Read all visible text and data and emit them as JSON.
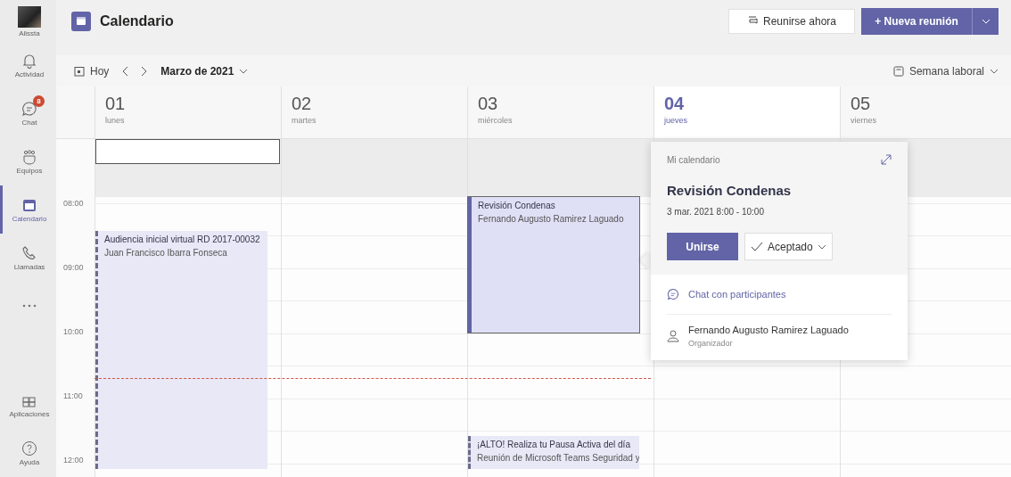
{
  "rail": {
    "profile": {
      "label": "Alissta"
    },
    "items": [
      {
        "label": "Actividad",
        "selected": false
      },
      {
        "label": "Chat",
        "selected": false,
        "badge": "8"
      },
      {
        "label": "Equipos",
        "selected": false
      },
      {
        "label": "Calendario",
        "selected": true
      },
      {
        "label": "Llamadas",
        "selected": false
      },
      {
        "selected": false
      }
    ],
    "bottom_items": [
      {
        "label": "Aplicaciones",
        "selected": false
      },
      {
        "label": "Ayuda",
        "selected": false
      }
    ]
  },
  "header": {
    "title": "Calendario",
    "meet_now": "Reunirse ahora",
    "new_meeting": "+ Nueva reunión"
  },
  "toolbar": {
    "today": "Hoy",
    "month": "Marzo de 2021",
    "view": "Semana laboral"
  },
  "times": [
    "08:00",
    "09:00",
    "10:00",
    "11:00",
    "12:00"
  ],
  "days": [
    {
      "number": "01",
      "weekday": "lunes",
      "selected": false,
      "events": [
        {
          "kind": "outline",
          "selected": false
        },
        {
          "kind": "tentative",
          "title": "Audiencia inicial virtual RD 2017-00032",
          "subtitle": "Juan Francisco Ibarra Fonseca",
          "selected": false
        }
      ]
    },
    {
      "number": "02",
      "weekday": "martes",
      "selected": false
    },
    {
      "number": "03",
      "weekday": "miércoles",
      "selected": false,
      "events": [
        {
          "kind": "busy",
          "title": "Revisión Condenas",
          "subtitle": "Fernando Augusto Ramirez Laguado",
          "selected": true
        },
        {
          "kind": "tentative",
          "title": "¡ALTO! Realiza tu Pausa Activa del día",
          "subtitle": "Reunión de Microsoft Teams  Seguridad y",
          "selected": false
        }
      ]
    },
    {
      "number": "04",
      "weekday": "jueves",
      "selected": true
    },
    {
      "number": "05",
      "weekday": "viernes",
      "selected": false
    }
  ],
  "popup": {
    "calendar": "Mi calendario",
    "title": "Revisión Condenas",
    "when": "3 mar. 2021 8:00 - 10:00",
    "join": "Unirse",
    "response": "Aceptado",
    "chat": "Chat con participantes",
    "organizer": {
      "name": "Fernando Augusto Ramirez Laguado",
      "role": "Organizador"
    }
  }
}
